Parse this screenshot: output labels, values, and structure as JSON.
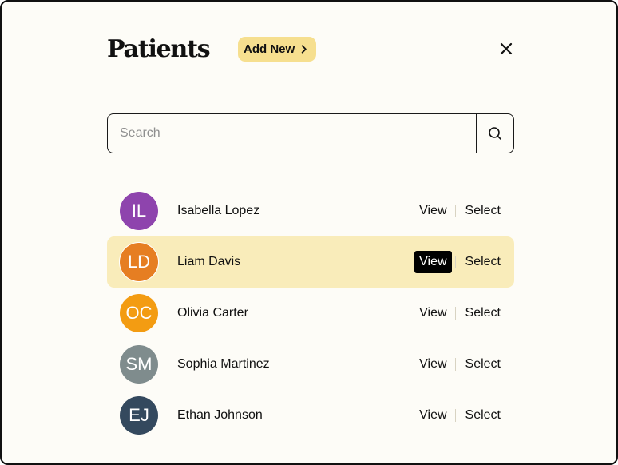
{
  "header": {
    "title": "Patients",
    "add_label": "Add New"
  },
  "search": {
    "placeholder": "Search",
    "value": ""
  },
  "patients": [
    {
      "initials": "IL",
      "name": "Isabella Lopez",
      "color": "#8e44ad",
      "view_label": "View",
      "select_label": "Select"
    },
    {
      "initials": "LD",
      "name": "Liam Davis",
      "color": "#e67e22",
      "view_label": "View",
      "select_label": "Select"
    },
    {
      "initials": "OC",
      "name": "Olivia Carter",
      "color": "#f39c12",
      "view_label": "View",
      "select_label": "Select"
    },
    {
      "initials": "SM",
      "name": "Sophia Martinez",
      "color": "#7f8c8d",
      "view_label": "View",
      "select_label": "Select"
    },
    {
      "initials": "EJ",
      "name": "Ethan Johnson",
      "color": "#34495e",
      "view_label": "View",
      "select_label": "Select"
    }
  ],
  "colors": {
    "accent": "#f6df8f",
    "highlight_row": "#f9ecba",
    "background": "#fdfcf7"
  },
  "icons": {
    "add": "chevron-right-icon",
    "close": "close-icon",
    "search": "search-icon"
  }
}
